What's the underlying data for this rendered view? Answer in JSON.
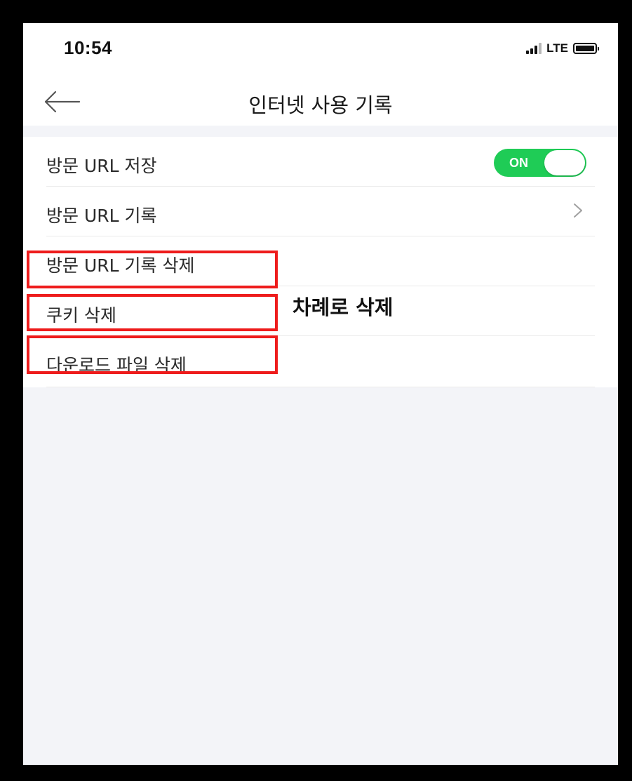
{
  "status_bar": {
    "time": "10:54",
    "network": "LTE",
    "icons": [
      "signal-icon",
      "battery-icon"
    ]
  },
  "header": {
    "title": "인터넷 사용 기록",
    "back_icon": "back-arrow-icon"
  },
  "settings": {
    "save_visited_url": {
      "label": "방문 URL 저장",
      "toggle_label": "ON",
      "enabled": true
    },
    "visited_url_history": {
      "label": "방문 URL 기록",
      "icon": "chevron-right-icon"
    },
    "delete_visited_url_history": {
      "label": "방문 URL 기록 삭제"
    },
    "delete_cookies": {
      "label": "쿠키 삭제"
    },
    "delete_downloaded_files": {
      "label": "다운로드 파일 삭제"
    }
  },
  "annotation": {
    "text": "차례로 삭제",
    "highlight_color": "#ee1c1c"
  },
  "colors": {
    "toggle_on": "#1fcc56",
    "background": "#f3f4f8",
    "frame": "#000000"
  }
}
